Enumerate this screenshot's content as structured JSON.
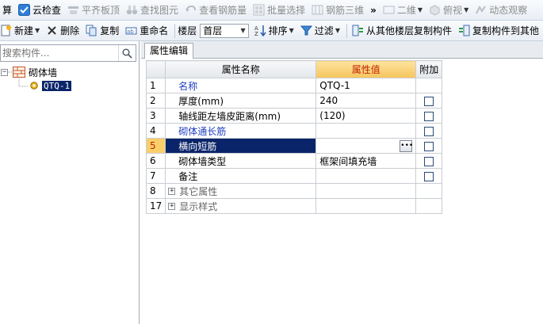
{
  "toolbar1": {
    "items": [
      {
        "label": "算",
        "icon": "calc-icon",
        "disabled": false
      },
      {
        "label": "云检查",
        "icon": "cloud-check-icon",
        "disabled": false
      },
      {
        "label": "平齐板顶",
        "icon": "align-slab-icon",
        "disabled": true
      },
      {
        "label": "查找图元",
        "icon": "find-element-icon",
        "disabled": true
      },
      {
        "label": "查看钢筋量",
        "icon": "view-rebar-icon",
        "disabled": true
      },
      {
        "label": "批量选择",
        "icon": "batch-select-icon",
        "disabled": true
      },
      {
        "label": "钢筋三维",
        "icon": "rebar-3d-icon",
        "disabled": true
      }
    ],
    "overflow": "»",
    "view_mode": "二维",
    "view_angle": "俯视",
    "dynamic": "动态观察"
  },
  "toolbar2": {
    "new": "新建",
    "delete": "删除",
    "copy": "复制",
    "rename": "重命名",
    "floor_label": "楼层",
    "floor_value": "首层",
    "sort": "排序",
    "filter": "过滤",
    "copy_from_floor": "从其他楼层复制构件",
    "copy_to_floor": "复制构件到其他"
  },
  "left": {
    "search_placeholder": "搜索构件...",
    "tree": {
      "root": "砌体墙",
      "child": "QTQ-1"
    }
  },
  "right": {
    "tab": "属性编辑",
    "headers": {
      "name": "属性名称",
      "value": "属性值",
      "extra": "附加"
    },
    "rows": [
      {
        "no": "1",
        "name": "名称",
        "value": "QTQ-1",
        "style": "blue",
        "check": false,
        "selected": false,
        "expand": false
      },
      {
        "no": "2",
        "name": "厚度(mm)",
        "value": "240",
        "style": "normal",
        "check": true,
        "selected": false,
        "expand": false
      },
      {
        "no": "3",
        "name": "轴线距左墙皮距离(mm)",
        "value": "(120)",
        "style": "normal",
        "check": true,
        "selected": false,
        "expand": false
      },
      {
        "no": "4",
        "name": "砌体通长筋",
        "value": "",
        "style": "blue",
        "check": true,
        "selected": false,
        "expand": false
      },
      {
        "no": "5",
        "name": "横向短筋",
        "value": "",
        "style": "normal",
        "check": true,
        "selected": true,
        "expand": false
      },
      {
        "no": "6",
        "name": "砌体墙类型",
        "value": "框架间填充墙",
        "style": "normal",
        "check": true,
        "selected": false,
        "expand": false
      },
      {
        "no": "7",
        "name": "备注",
        "value": "",
        "style": "normal",
        "check": true,
        "selected": false,
        "expand": false
      },
      {
        "no": "8",
        "name": "其它属性",
        "value": "",
        "style": "grey",
        "check": false,
        "selected": false,
        "expand": true
      },
      {
        "no": "17",
        "name": "显示样式",
        "value": "",
        "style": "grey",
        "check": false,
        "selected": false,
        "expand": true
      }
    ]
  },
  "colors": {
    "selection": "#0a246a",
    "value_header": "#f7c45c",
    "value_header_text": "#c22200",
    "blue_text": "#1f3fbf"
  }
}
